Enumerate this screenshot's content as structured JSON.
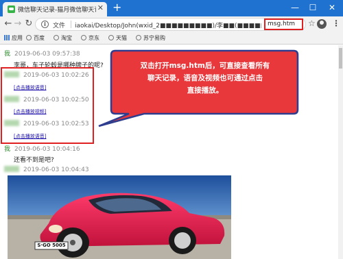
{
  "browser": {
    "tab_title": "微信聊天记录-猫月微信聊天记",
    "tab_close": "✕",
    "new_tab": "+",
    "window_buttons": {
      "minimize": "—",
      "maximize": "☐",
      "close": "✕"
    },
    "nav": {
      "back": "←",
      "forward": "→",
      "reload": "↻"
    },
    "omnibox_label": "文件",
    "url_path": "iaokai/Desktop/John(wxid_2■■■■■■■■■)/李■■(■■■■■■)/",
    "url_file": "msg.htm",
    "bookmarks": [
      "应用",
      "百度",
      "淘宝",
      "京东",
      "天猫",
      "苏宁易购"
    ]
  },
  "messages": [
    {
      "sender": "我",
      "time": "2019-06-03 09:57:38",
      "text": "李哥，车子轮毂是哪种牌子的呢?"
    },
    {
      "sender": "",
      "time": "2019-06-03 10:02:26",
      "link": "[点击播放语音]"
    },
    {
      "sender": "",
      "time": "2019-06-03 10:02:50",
      "link": "[点击播放视频]"
    },
    {
      "sender": "",
      "time": "2019-06-03 10:02:53",
      "link": "[点击播放语音]"
    },
    {
      "sender": "我",
      "time": "2019-06-03 10:04:16",
      "text": "还看不到是吧?"
    },
    {
      "sender": "",
      "time": "2019-06-03 10:04:43"
    }
  ],
  "callout": {
    "lines": [
      "双击打开msg.htm后，可直接查看所有",
      "聊天记录，语音及视频也可通过点击",
      "直接播放。"
    ]
  },
  "photo": {
    "plate": "S·GO 5005"
  },
  "colors": {
    "titlebar": "#1f72cf",
    "callout_fill": "#e8383b",
    "callout_border": "#2f3d8f",
    "highlight": "#e02020"
  }
}
